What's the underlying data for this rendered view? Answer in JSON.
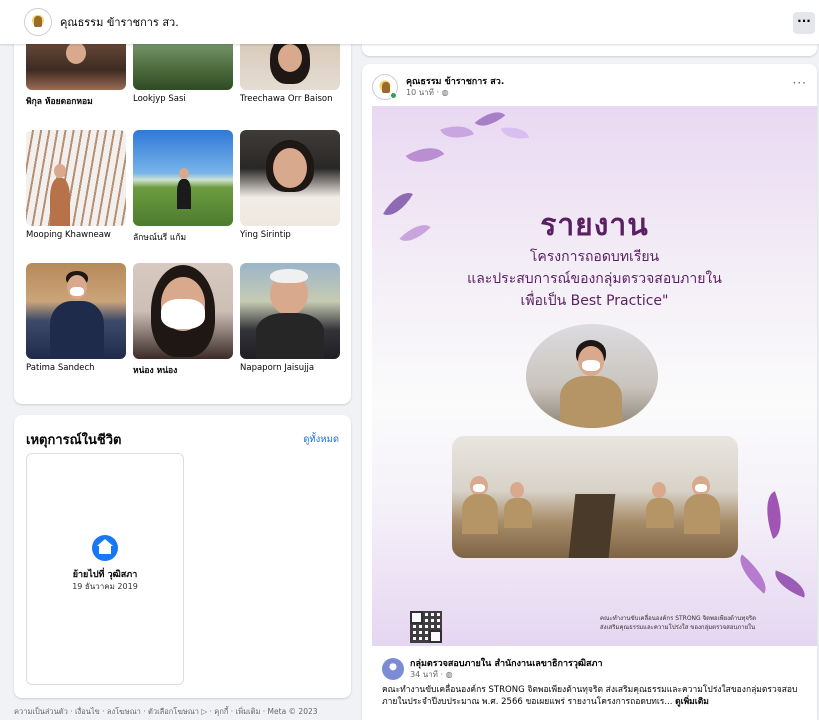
{
  "topbar": {
    "page_name": "คุณธรรม ข้าราชการ สว.",
    "more_label": "···"
  },
  "friends": [
    {
      "name": "พิกุล ห้อยดอกหอม"
    },
    {
      "name": "Lookjyp Sasi"
    },
    {
      "name": "Treechawa Orr Baison"
    },
    {
      "name": "Mooping Khawneaw"
    },
    {
      "name": "ลักษณ์นรี แก้ม"
    },
    {
      "name": "Ying Sirintip"
    },
    {
      "name": "Patima Sandech"
    },
    {
      "name": "หน่อง หน่อง"
    },
    {
      "name": "Napaporn Jaisujja"
    }
  ],
  "life_events": {
    "title": "เหตุการณ์ในชีวิต",
    "see_all": "ดูทั้งหมด",
    "event_title": "ย้ายไปที่ วุฒิสภา",
    "event_date": "19 ธันวาคม 2019",
    "event_icon": "home-icon",
    "accent": "#1877f2"
  },
  "footer": {
    "text": "ความเป็นส่วนตัว · เงื่อนไข · ลงโฆษณา · ตัวเลือกโฆษณา ▷ · คุกกี้ · เพิ่มเติม · Meta © 2023"
  },
  "post": {
    "author": "คุณธรรม ข้าราชการ สว.",
    "time": "10 นาที · ◍",
    "more": "···",
    "image": {
      "title": "รายงาน",
      "line1": "โครงการถอดบทเรียน",
      "line2": "และประสบการณ์ของกลุ่มตรวจสอบภายใน",
      "line3": "เพื่อเป็น Best Practice\"",
      "caption_1": "คณะทำงานขับเคลื่อนองค์กร STRONG จิตพอเพียงต้านทุจริต",
      "caption_2": "ส่งเสริมคุณธรรมและความโปร่งใส ของกลุ่มตรวจสอบภายใน"
    },
    "shared": {
      "name": "กลุ่มตรวจสอบภายใน สำนักงานเลขาธิการวุฒิสภา",
      "time": "34 นาที · ◍",
      "text": "คณะทำงานขับเคลื่อนองค์กร STRONG จิตพอเพียงต้านทุจริต ส่งเสริมคุณธรรมและความโปร่งใสของกลุ่มตรวจสอบภายในประจำปีงบประมาณ พ.ศ. 2566 ขอเผยแพร่ รายงานโครงการถอดบทเร...",
      "see_more": "ดูเพิ่มเติม"
    }
  }
}
